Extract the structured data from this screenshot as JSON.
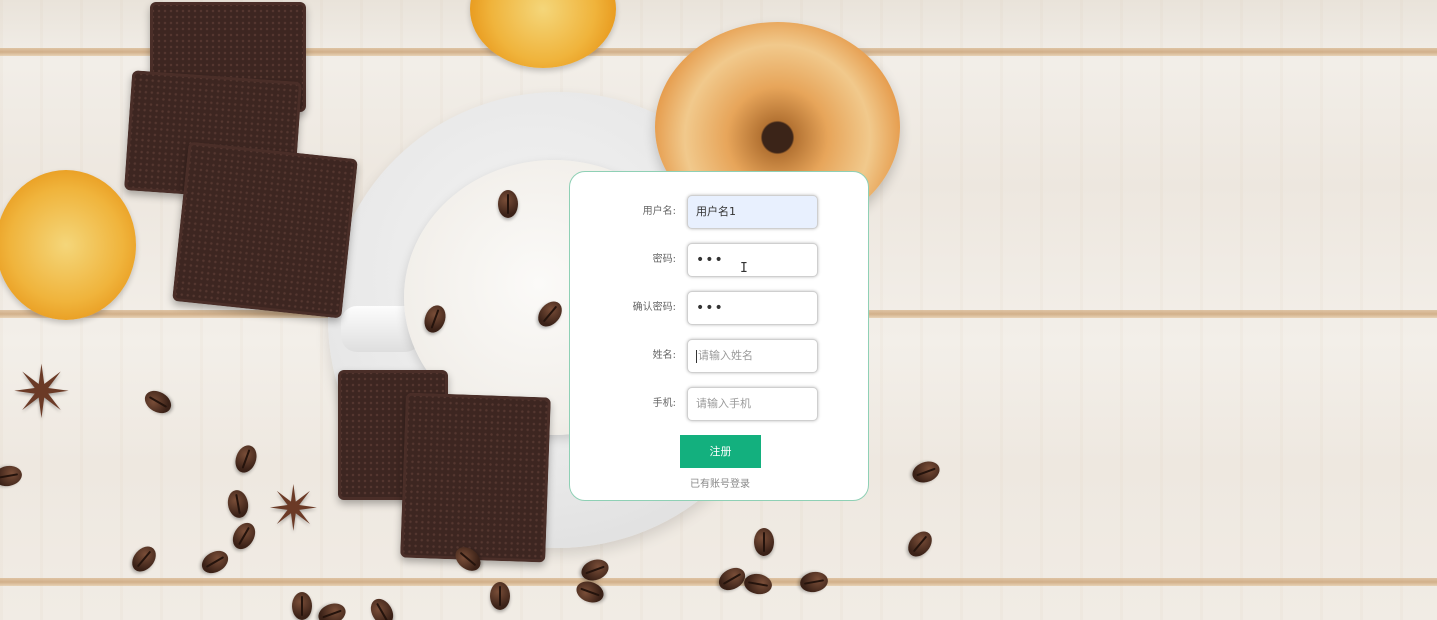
{
  "form": {
    "fields": [
      {
        "label": "用户名:",
        "value": "用户名1",
        "placeholder": ""
      },
      {
        "label": "密码:",
        "value": "•••",
        "placeholder": ""
      },
      {
        "label": "确认密码:",
        "value": "•••",
        "placeholder": ""
      },
      {
        "label": "姓名:",
        "value": "",
        "placeholder": "请输入姓名"
      },
      {
        "label": "手机:",
        "value": "",
        "placeholder": "请输入手机"
      }
    ],
    "submit_label": "注册",
    "login_link": "已有账号登录"
  },
  "colors": {
    "accent": "#13b07e",
    "card_border": "#8fd0b5",
    "autofill_bg": "#e8f0fe"
  },
  "icons": {
    "text_cursor": "text-cursor-icon"
  }
}
